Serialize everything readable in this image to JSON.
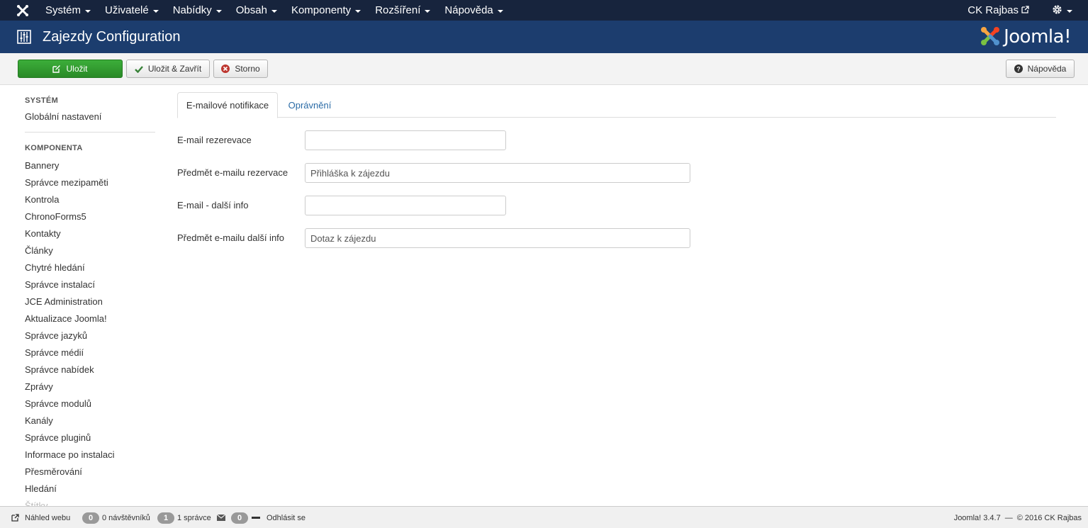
{
  "navbar": {
    "menu": [
      "Systém",
      "Uživatelé",
      "Nabídky",
      "Obsah",
      "Komponenty",
      "Rozšíření",
      "Nápověda"
    ],
    "user": "CK Rajbas"
  },
  "header": {
    "title": "Zajezdy Configuration",
    "brand": "Joomla!"
  },
  "toolbar": {
    "save": "Uložit",
    "save_close": "Uložit & Zavřít",
    "cancel": "Storno",
    "help": "Nápověda"
  },
  "sidebar": {
    "system_header": "SYSTÉM",
    "system_items": [
      "Globální nastavení"
    ],
    "component_header": "KOMPONENTA",
    "component_items": [
      "Bannery",
      "Správce mezipaměti",
      "Kontrola",
      "ChronoForms5",
      "Kontakty",
      "Články",
      "Chytré hledání",
      "Správce instalací",
      "JCE Administration",
      "Aktualizace Joomla!",
      "Správce jazyků",
      "Správce médií",
      "Správce nabídek",
      "Zprávy",
      "Správce modulů",
      "Kanály",
      "Správce pluginů",
      "Informace po instalaci",
      "Přesměrování",
      "Hledání",
      "Štítky"
    ]
  },
  "tabs": [
    "E-mailové notifikace",
    "Oprávnění"
  ],
  "form": {
    "fields": [
      {
        "label": "E-mail rezerevace",
        "value": ""
      },
      {
        "label": "Předmět e-mailu rezervace",
        "value": "Přihláška k zájezdu"
      },
      {
        "label": "E-mail - další info",
        "value": ""
      },
      {
        "label": "Předmět e-mailu další info",
        "value": "Dotaz k zájezdu"
      }
    ]
  },
  "statusbar": {
    "preview": "Náhled webu",
    "visitors_count": "0",
    "visitors_label": "0 návštěvníků",
    "admins_count": "1",
    "admins_label": "1 správce",
    "messages_count": "0",
    "logout": "Odhlásit se",
    "version": "Joomla! 3.4.7",
    "copyright": "© 2016 CK Rajbas"
  },
  "colors": {
    "navbar_bg": "#17243d",
    "header_bg": "#1c3d6e",
    "save_green": "#2f9a2d",
    "link_blue": "#2a6ba6"
  }
}
